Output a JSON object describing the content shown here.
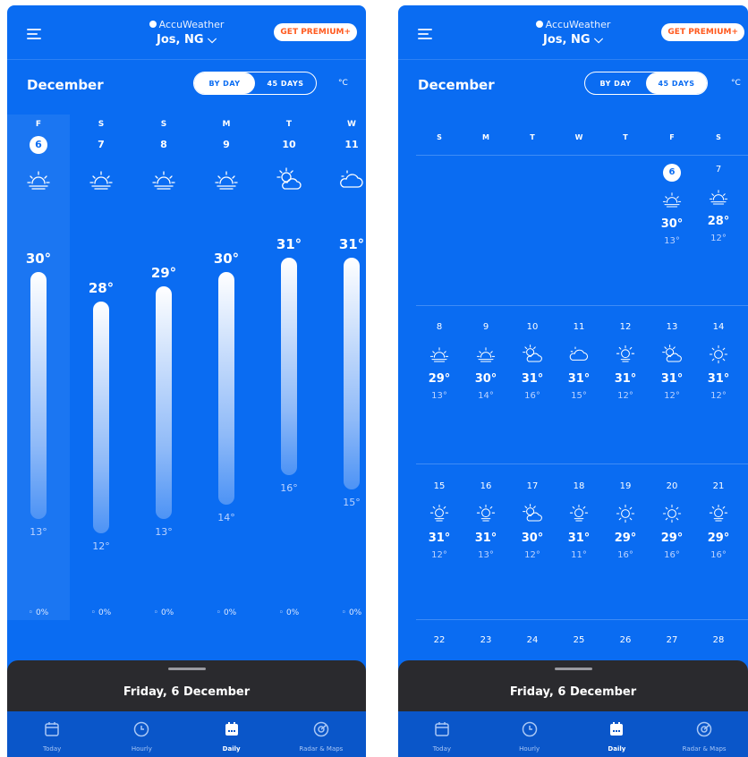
{
  "left": {
    "brand": "AccuWeather",
    "city": "Jos, NG",
    "premium": "GET PREMIUM+",
    "month": "December",
    "toggle": {
      "by_day": "BY DAY",
      "days45": "45 DAYS"
    },
    "unit": "°C",
    "days": [
      {
        "dow": "F",
        "date": "6",
        "icon": "sunrise-icon",
        "high": "30°",
        "low": "13°",
        "precip": "0%",
        "high_val": 30,
        "low_val": 13
      },
      {
        "dow": "S",
        "date": "7",
        "icon": "sunrise-icon",
        "high": "28°",
        "low": "12°",
        "precip": "0%",
        "high_val": 28,
        "low_val": 12
      },
      {
        "dow": "S",
        "date": "8",
        "icon": "sunrise-icon",
        "high": "29°",
        "low": "13°",
        "precip": "0%",
        "high_val": 29,
        "low_val": 13
      },
      {
        "dow": "M",
        "date": "9",
        "icon": "sunrise-icon",
        "high": "30°",
        "low": "14°",
        "precip": "0%",
        "high_val": 30,
        "low_val": 14
      },
      {
        "dow": "T",
        "date": "10",
        "icon": "partly-cloudy-icon",
        "high": "31°",
        "low": "16°",
        "precip": "0%",
        "high_val": 31,
        "low_val": 16
      },
      {
        "dow": "W",
        "date": "11",
        "icon": "cloudy-icon",
        "high": "31°",
        "low": "15°",
        "precip": "0%",
        "high_val": 31,
        "low_val": 15
      }
    ],
    "sheet_title": "Friday, 6 December",
    "tabs": [
      "Today",
      "Hourly",
      "Daily",
      "Radar & Maps"
    ]
  },
  "right": {
    "brand": "AccuWeather",
    "city": "Jos, NG",
    "premium": "GET PREMIUM+",
    "month": "December",
    "toggle": {
      "by_day": "BY DAY",
      "days45": "45 DAYS"
    },
    "unit": "°C",
    "dows": [
      "S",
      "M",
      "T",
      "W",
      "T",
      "F",
      "S"
    ],
    "weeks": [
      [
        {
          "date": "6",
          "icon": "sunrise-icon",
          "high": "30°",
          "low": "13°"
        },
        {
          "date": "7",
          "icon": "sunrise-icon",
          "high": "28°",
          "low": "12°"
        }
      ],
      [
        {
          "date": "8",
          "icon": "sunrise-icon",
          "high": "29°",
          "low": "13°"
        },
        {
          "date": "9",
          "icon": "sunrise-icon",
          "high": "30°",
          "low": "14°"
        },
        {
          "date": "10",
          "icon": "partly-cloudy-icon",
          "high": "31°",
          "low": "16°"
        },
        {
          "date": "11",
          "icon": "cloudy-icon",
          "high": "31°",
          "low": "15°"
        },
        {
          "date": "12",
          "icon": "hazy-sun-icon",
          "high": "31°",
          "low": "12°"
        },
        {
          "date": "13",
          "icon": "partly-cloudy-icon",
          "high": "31°",
          "low": "12°"
        },
        {
          "date": "14",
          "icon": "sun-icon",
          "high": "31°",
          "low": "12°"
        }
      ],
      [
        {
          "date": "15",
          "icon": "hazy-sun-icon",
          "high": "31°",
          "low": "12°"
        },
        {
          "date": "16",
          "icon": "hazy-sun-icon",
          "high": "31°",
          "low": "13°"
        },
        {
          "date": "17",
          "icon": "partly-cloudy-icon",
          "high": "30°",
          "low": "12°"
        },
        {
          "date": "18",
          "icon": "hazy-sun-icon",
          "high": "31°",
          "low": "11°"
        },
        {
          "date": "19",
          "icon": "sun-icon",
          "high": "29°",
          "low": "16°"
        },
        {
          "date": "20",
          "icon": "sun-icon",
          "high": "29°",
          "low": "16°"
        },
        {
          "date": "21",
          "icon": "hazy-sun-icon",
          "high": "29°",
          "low": "16°"
        }
      ],
      [
        {
          "date": "22"
        },
        {
          "date": "23"
        },
        {
          "date": "24"
        },
        {
          "date": "25"
        },
        {
          "date": "26"
        },
        {
          "date": "27"
        },
        {
          "date": "28"
        }
      ]
    ],
    "sheet_title": "Friday, 6 December",
    "tabs": [
      "Today",
      "Hourly",
      "Daily",
      "Radar & Maps"
    ]
  },
  "colors": {
    "background": "#0a6cf2",
    "sheet": "#2a2a2e",
    "premium_text": "#ff5a1f"
  }
}
